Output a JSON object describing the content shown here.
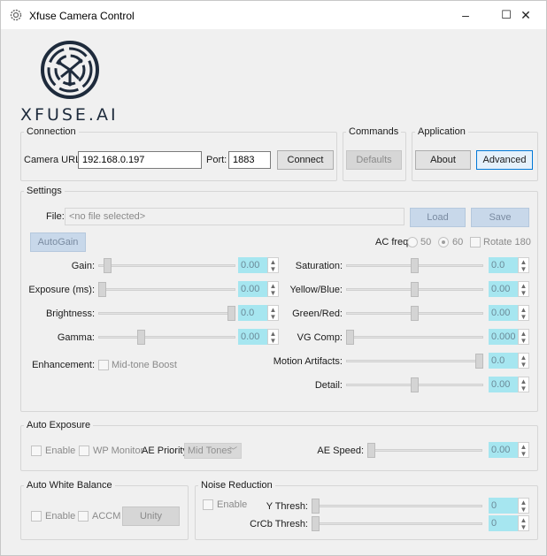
{
  "window": {
    "title": "Xfuse Camera Control",
    "minimize": "–",
    "maximize": "☐",
    "close": "✕",
    "app_icon": "gear-icon"
  },
  "logo": {
    "text": "XFUSE.AI"
  },
  "connection": {
    "title": "Connection",
    "camera_url_label": "Camera URL:",
    "camera_url_value": "192.168.0.197",
    "port_label": "Port:",
    "port_value": "1883",
    "connect_label": "Connect"
  },
  "commands": {
    "title": "Commands",
    "defaults_label": "Defaults"
  },
  "application": {
    "title": "Application",
    "about_label": "About",
    "advanced_label": "Advanced"
  },
  "settings": {
    "title": "Settings",
    "file_label": "File:",
    "file_placeholder": "<no file selected>",
    "load_label": "Load",
    "save_label": "Save",
    "autogain_label": "AutoGain",
    "ac_freq_label": "AC freq",
    "ac_50": "50",
    "ac_60": "60",
    "ac_selected": "60",
    "rotate_label": "Rotate 180",
    "left": [
      {
        "label": "Gain:",
        "value": "0.00",
        "level": 0.04
      },
      {
        "label": "Exposure (ms):",
        "value": "0.00",
        "level": 0.0
      },
      {
        "label": "Brightness:",
        "value": "0.0",
        "level": 1.0
      },
      {
        "label": "Gamma:",
        "value": "0.00",
        "level": 0.3
      }
    ],
    "right": [
      {
        "label": "Saturation:",
        "value": "0.0",
        "level": 0.5
      },
      {
        "label": "Yellow/Blue:",
        "value": "0.00",
        "level": 0.5
      },
      {
        "label": "Green/Red:",
        "value": "0.00",
        "level": 0.5
      },
      {
        "label": "VG Comp:",
        "value": "0.000",
        "level": 0.0
      },
      {
        "label": "Motion Artifacts:",
        "value": "0.0",
        "level": 1.0
      },
      {
        "label": "Detail:",
        "value": "0.00",
        "level": 0.5
      }
    ],
    "enhancement_label": "Enhancement:",
    "midtone_label": "Mid-tone Boost"
  },
  "auto_exposure": {
    "title": "Auto Exposure",
    "enable_label": "Enable",
    "wp_monitor_label": "WP Monitor",
    "ae_priority_label": "AE Priority",
    "ae_priority_value": "Mid Tones",
    "ae_speed_label": "AE Speed:",
    "ae_speed_value": "0.00",
    "ae_speed_level": 0.0
  },
  "auto_white_balance": {
    "title": "Auto White Balance",
    "enable_label": "Enable",
    "accm_label": "ACCM",
    "unity_label": "Unity"
  },
  "noise_reduction": {
    "title": "Noise Reduction",
    "enable_label": "Enable",
    "y_thresh_label": "Y Thresh:",
    "y_thresh_value": "0",
    "y_thresh_level": 0.0,
    "crcb_thresh_label": "CrCb Thresh:",
    "crcb_thresh_value": "0",
    "crcb_thresh_level": 0.0
  },
  "colors": {
    "accent": "#0078d7",
    "spin_fill": "#a6e6f0",
    "disabled_button": "#c8d8ea"
  }
}
